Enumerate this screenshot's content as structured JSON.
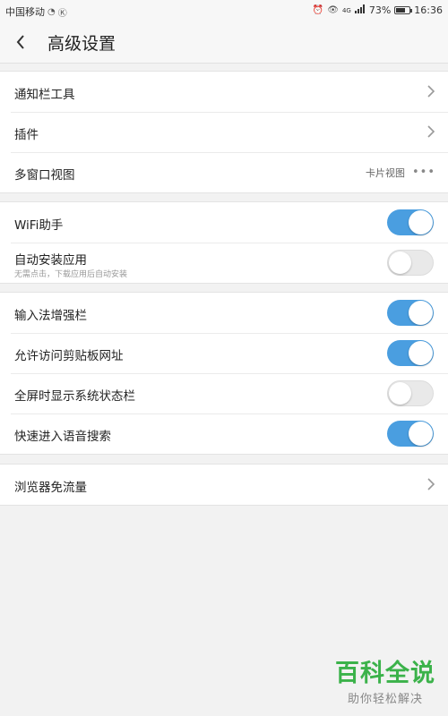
{
  "status_bar": {
    "carrier": "中国移动",
    "battery": "73%",
    "battery_level": 0.73,
    "time": "16:36",
    "network": "4G"
  },
  "header": {
    "title": "高级设置",
    "back_icon": "chevron-left-icon"
  },
  "sections": [
    {
      "rows": [
        {
          "label": "通知栏工具",
          "control": "chevron"
        },
        {
          "label": "插件",
          "control": "chevron"
        },
        {
          "label": "多窗口视图",
          "control": "value",
          "value": "卡片视图"
        }
      ]
    },
    {
      "rows": [
        {
          "label": "WiFi助手",
          "control": "toggle",
          "on": true
        },
        {
          "label": "自动安装应用",
          "sub": "无需点击，下载应用后自动安装",
          "control": "toggle",
          "on": false
        }
      ]
    },
    {
      "rows": [
        {
          "label": "输入法增强栏",
          "control": "toggle",
          "on": true
        },
        {
          "label": "允许访问剪贴板网址",
          "control": "toggle",
          "on": true
        },
        {
          "label": "全屏时显示系统状态栏",
          "control": "toggle",
          "on": false
        },
        {
          "label": "快速进入语音搜索",
          "control": "toggle",
          "on": true
        }
      ]
    },
    {
      "rows": [
        {
          "label": "浏览器免流量",
          "control": "chevron"
        }
      ]
    }
  ],
  "watermark": {
    "title": "百科全说",
    "subtitle": "助你轻松解决"
  },
  "colors": {
    "toggle_on": "#4a9ee0",
    "toggle_off": "#e9e9e9",
    "watermark": "#3bb24a"
  }
}
